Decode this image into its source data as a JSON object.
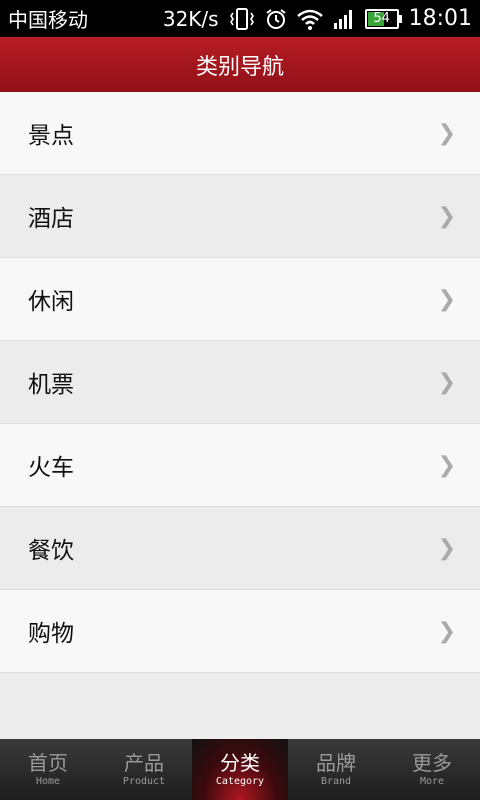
{
  "status_bar": {
    "carrier": "中国移动",
    "speed": "32K/s",
    "battery": "54",
    "time": "18:01",
    "icons": [
      "vibrate-icon",
      "alarm-icon",
      "wifi-icon",
      "signal-icon",
      "battery-icon"
    ]
  },
  "header": {
    "title": "类别导航"
  },
  "categories": [
    {
      "label": "景点"
    },
    {
      "label": "酒店"
    },
    {
      "label": "休闲"
    },
    {
      "label": "机票"
    },
    {
      "label": "火车"
    },
    {
      "label": "餐饮"
    },
    {
      "label": "购物"
    }
  ],
  "chevron": "❯",
  "bottom_nav": {
    "tabs": [
      {
        "label": "首页",
        "sub": "Home",
        "active": false
      },
      {
        "label": "产品",
        "sub": "Product",
        "active": false
      },
      {
        "label": "分类",
        "sub": "Category",
        "active": true
      },
      {
        "label": "品牌",
        "sub": "Brand",
        "active": false
      },
      {
        "label": "更多",
        "sub": "More",
        "active": false
      }
    ]
  },
  "colors": {
    "header": "#a5161e",
    "nav_active": "#b01620",
    "battery": "#3aa53a"
  }
}
